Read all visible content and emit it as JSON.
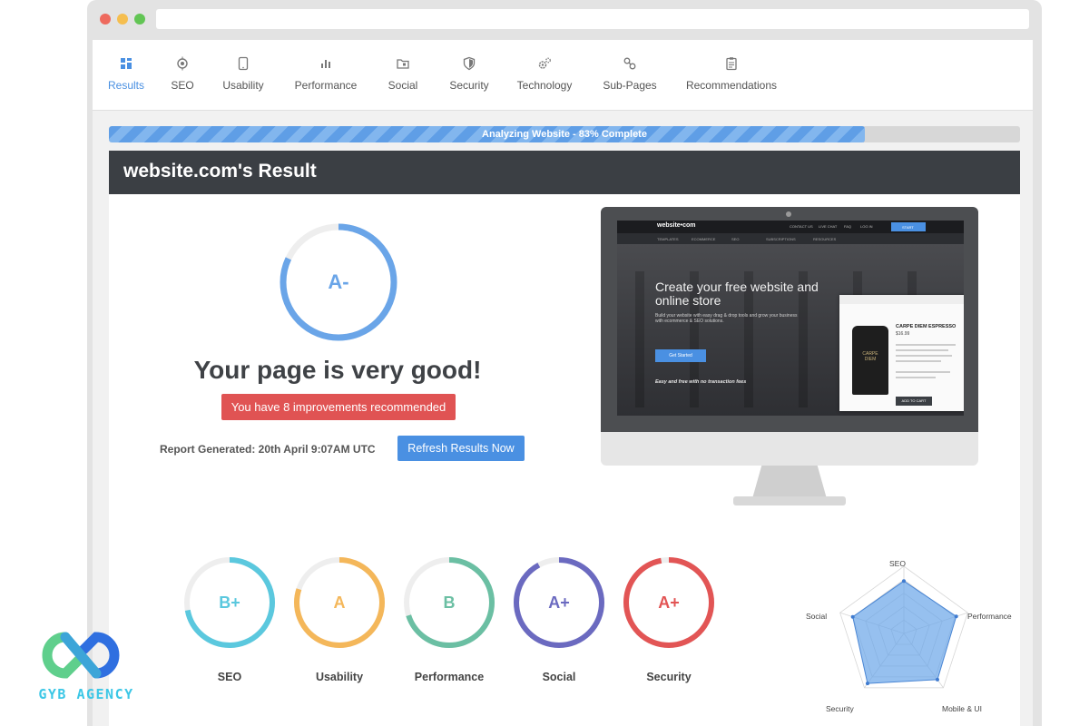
{
  "tabs": [
    {
      "label": "Results",
      "icon": "grid-icon",
      "active": true
    },
    {
      "label": "SEO",
      "icon": "target-icon"
    },
    {
      "label": "Usability",
      "icon": "tablet-icon"
    },
    {
      "label": "Performance",
      "icon": "bar-chart-icon"
    },
    {
      "label": "Social",
      "icon": "folder-icon"
    },
    {
      "label": "Security",
      "icon": "shield-icon"
    },
    {
      "label": "Technology",
      "icon": "gears-icon"
    },
    {
      "label": "Sub-Pages",
      "icon": "link-icon"
    },
    {
      "label": "Recommendations",
      "icon": "clipboard-icon"
    }
  ],
  "progress": {
    "text": "Analyzing Website - 83% Complete",
    "percent": 83
  },
  "panel": {
    "title": "website.com's Result"
  },
  "overall": {
    "grade": "A-",
    "score_fraction": 0.82,
    "color": "#6aa5e8",
    "headline": "Your page is very good!",
    "improvements": "You have 8 improvements recommended",
    "report": "Report Generated: 20th April 9:07AM UTC",
    "refresh": "Refresh Results Now"
  },
  "screen": {
    "logo": "website•com",
    "nav": [
      "CONTACT US",
      "LIVE CHAT",
      "FAQ",
      "LOG IN"
    ],
    "cta_top": "START",
    "subnav": [
      "TEMPLATES",
      "ECOMMERCE",
      "SEO",
      "SUBSCRIPTIONS",
      "RESOURCES"
    ],
    "headline": "Create your free website and online store",
    "paragraph": "Build your website with easy drag & drop tools and grow your business with ecommerce & SEO solutions.",
    "button": "Get Started",
    "footer": "Easy and free with no transaction fees",
    "product": "CARPE DIEM ESPRESSO",
    "price": "$16.99",
    "bag_label": "CARPE DIEM",
    "add": "ADD TO CART"
  },
  "scores": [
    {
      "label": "SEO",
      "grade": "B+",
      "color": "#5bc8de",
      "fraction": 0.72
    },
    {
      "label": "Usability",
      "grade": "A",
      "color": "#f4b75a",
      "fraction": 0.8
    },
    {
      "label": "Performance",
      "grade": "B",
      "color": "#6bbfa3",
      "fraction": 0.7
    },
    {
      "label": "Social",
      "grade": "A+",
      "color": "#6b6ac0",
      "fraction": 0.92
    },
    {
      "label": "Security",
      "grade": "A+",
      "color": "#e25555",
      "fraction": 0.97
    }
  ],
  "radar": {
    "axes": [
      "SEO",
      "Performance",
      "Mobile & UI",
      "Security",
      "Social"
    ],
    "values": [
      0.78,
      0.82,
      0.85,
      0.92,
      0.8
    ],
    "color": "#6aa5e8"
  },
  "brand": {
    "text": "GYB AGENCY"
  }
}
